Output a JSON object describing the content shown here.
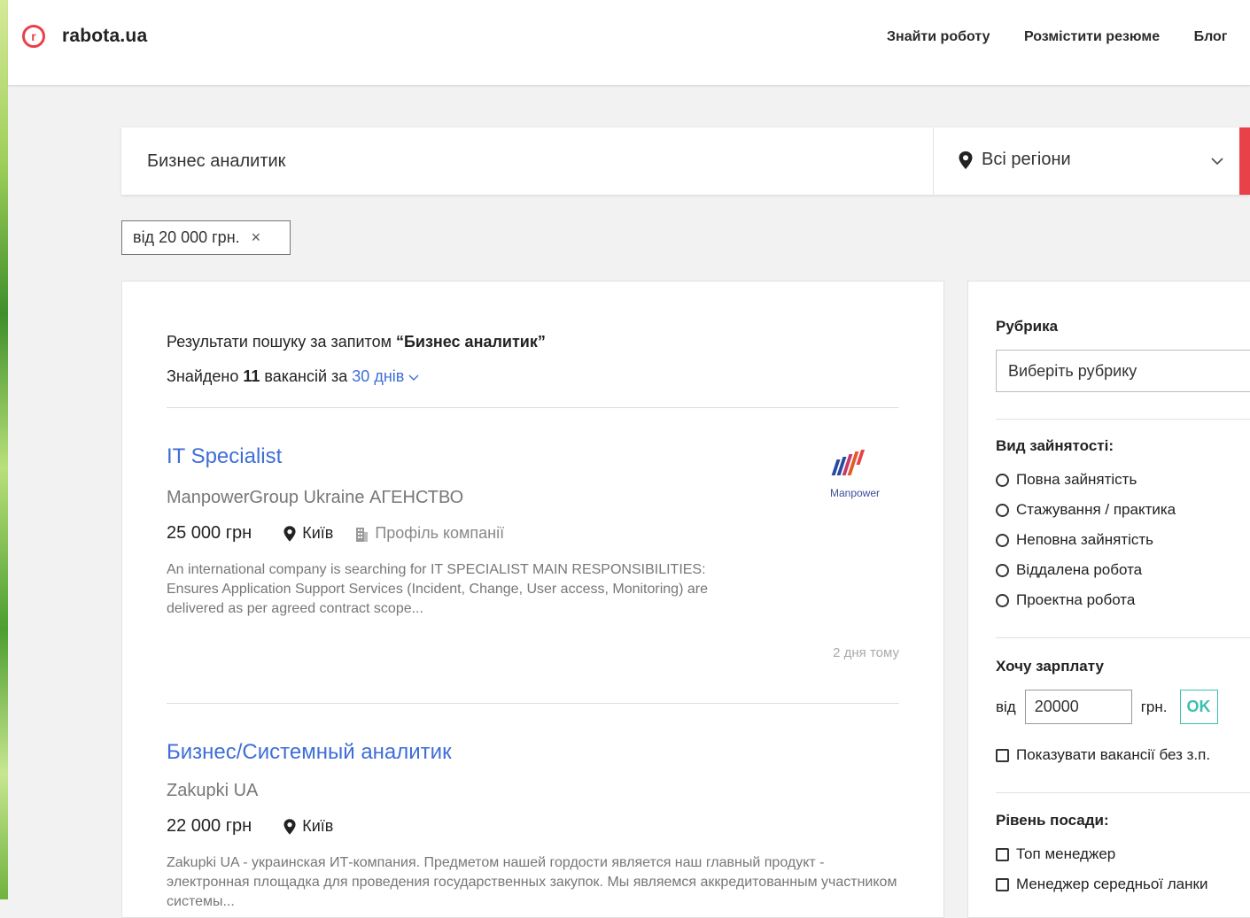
{
  "header": {
    "logo_glyph": "r",
    "logo_text": "rabota.ua",
    "nav": [
      "Знайти роботу",
      "Розмістити резюме",
      "Блог"
    ]
  },
  "search": {
    "query": "Бизнес аналитик",
    "region": "Всі регіони"
  },
  "filter_chip": {
    "label": "від 20 000 грн.",
    "close": "×"
  },
  "results": {
    "heading_prefix": "Результати пошуку за запитом ",
    "heading_query": "“Бизнес аналитик”",
    "count_prefix": "Знайдено ",
    "count_value": "11",
    "count_suffix": " вакансій за ",
    "period": "30 днів",
    "jobs": [
      {
        "title": "IT Specialist",
        "company": "ManpowerGroup Ukraine АГЕНСТВО",
        "salary": "25 000 грн",
        "city": "Київ",
        "profile": "Профіль компанії",
        "description": "An international company is searching for IT SPECIALIST MAIN RESPONSIBILITIES: Ensures Application Support Services (Incident, Change, User access, Monitoring) are delivered as per agreed contract scope...",
        "posted": "2 дня тому",
        "logo_text": "Manpower"
      },
      {
        "title": "Бизнес/Системный аналитик",
        "company": "Zakupki UA",
        "salary": "22 000 грн",
        "city": "Київ",
        "description": "Zakupki UA - украинская ИТ-компания. Предметом нашей гордости является наш главный продукт - электронная площадка для проведения государственных закупок. Мы являемся аккредитованным участником системы..."
      }
    ]
  },
  "sidebar": {
    "rubric_label": "Рубрика",
    "rubric_placeholder": "Виберіть рубрику",
    "employment_label": "Вид зайнятості:",
    "employment_options": [
      "Повна зайнятість",
      "Стажування / практика",
      "Неповна зайнятість",
      "Віддалена робота",
      "Проектна робота"
    ],
    "salary_label": "Хочу зарплату",
    "salary_from": "від",
    "salary_value": "20000",
    "salary_currency": "грн.",
    "salary_ok": "OK",
    "show_without_salary": "Показувати вакансії без з.п.",
    "level_label": "Рівень посади:",
    "level_options": [
      "Топ менеджер",
      "Менеджер середньої ланки"
    ]
  },
  "colors": {
    "brand": "#e8414a",
    "link": "#3f6ed6",
    "ok": "#3bbfae"
  }
}
